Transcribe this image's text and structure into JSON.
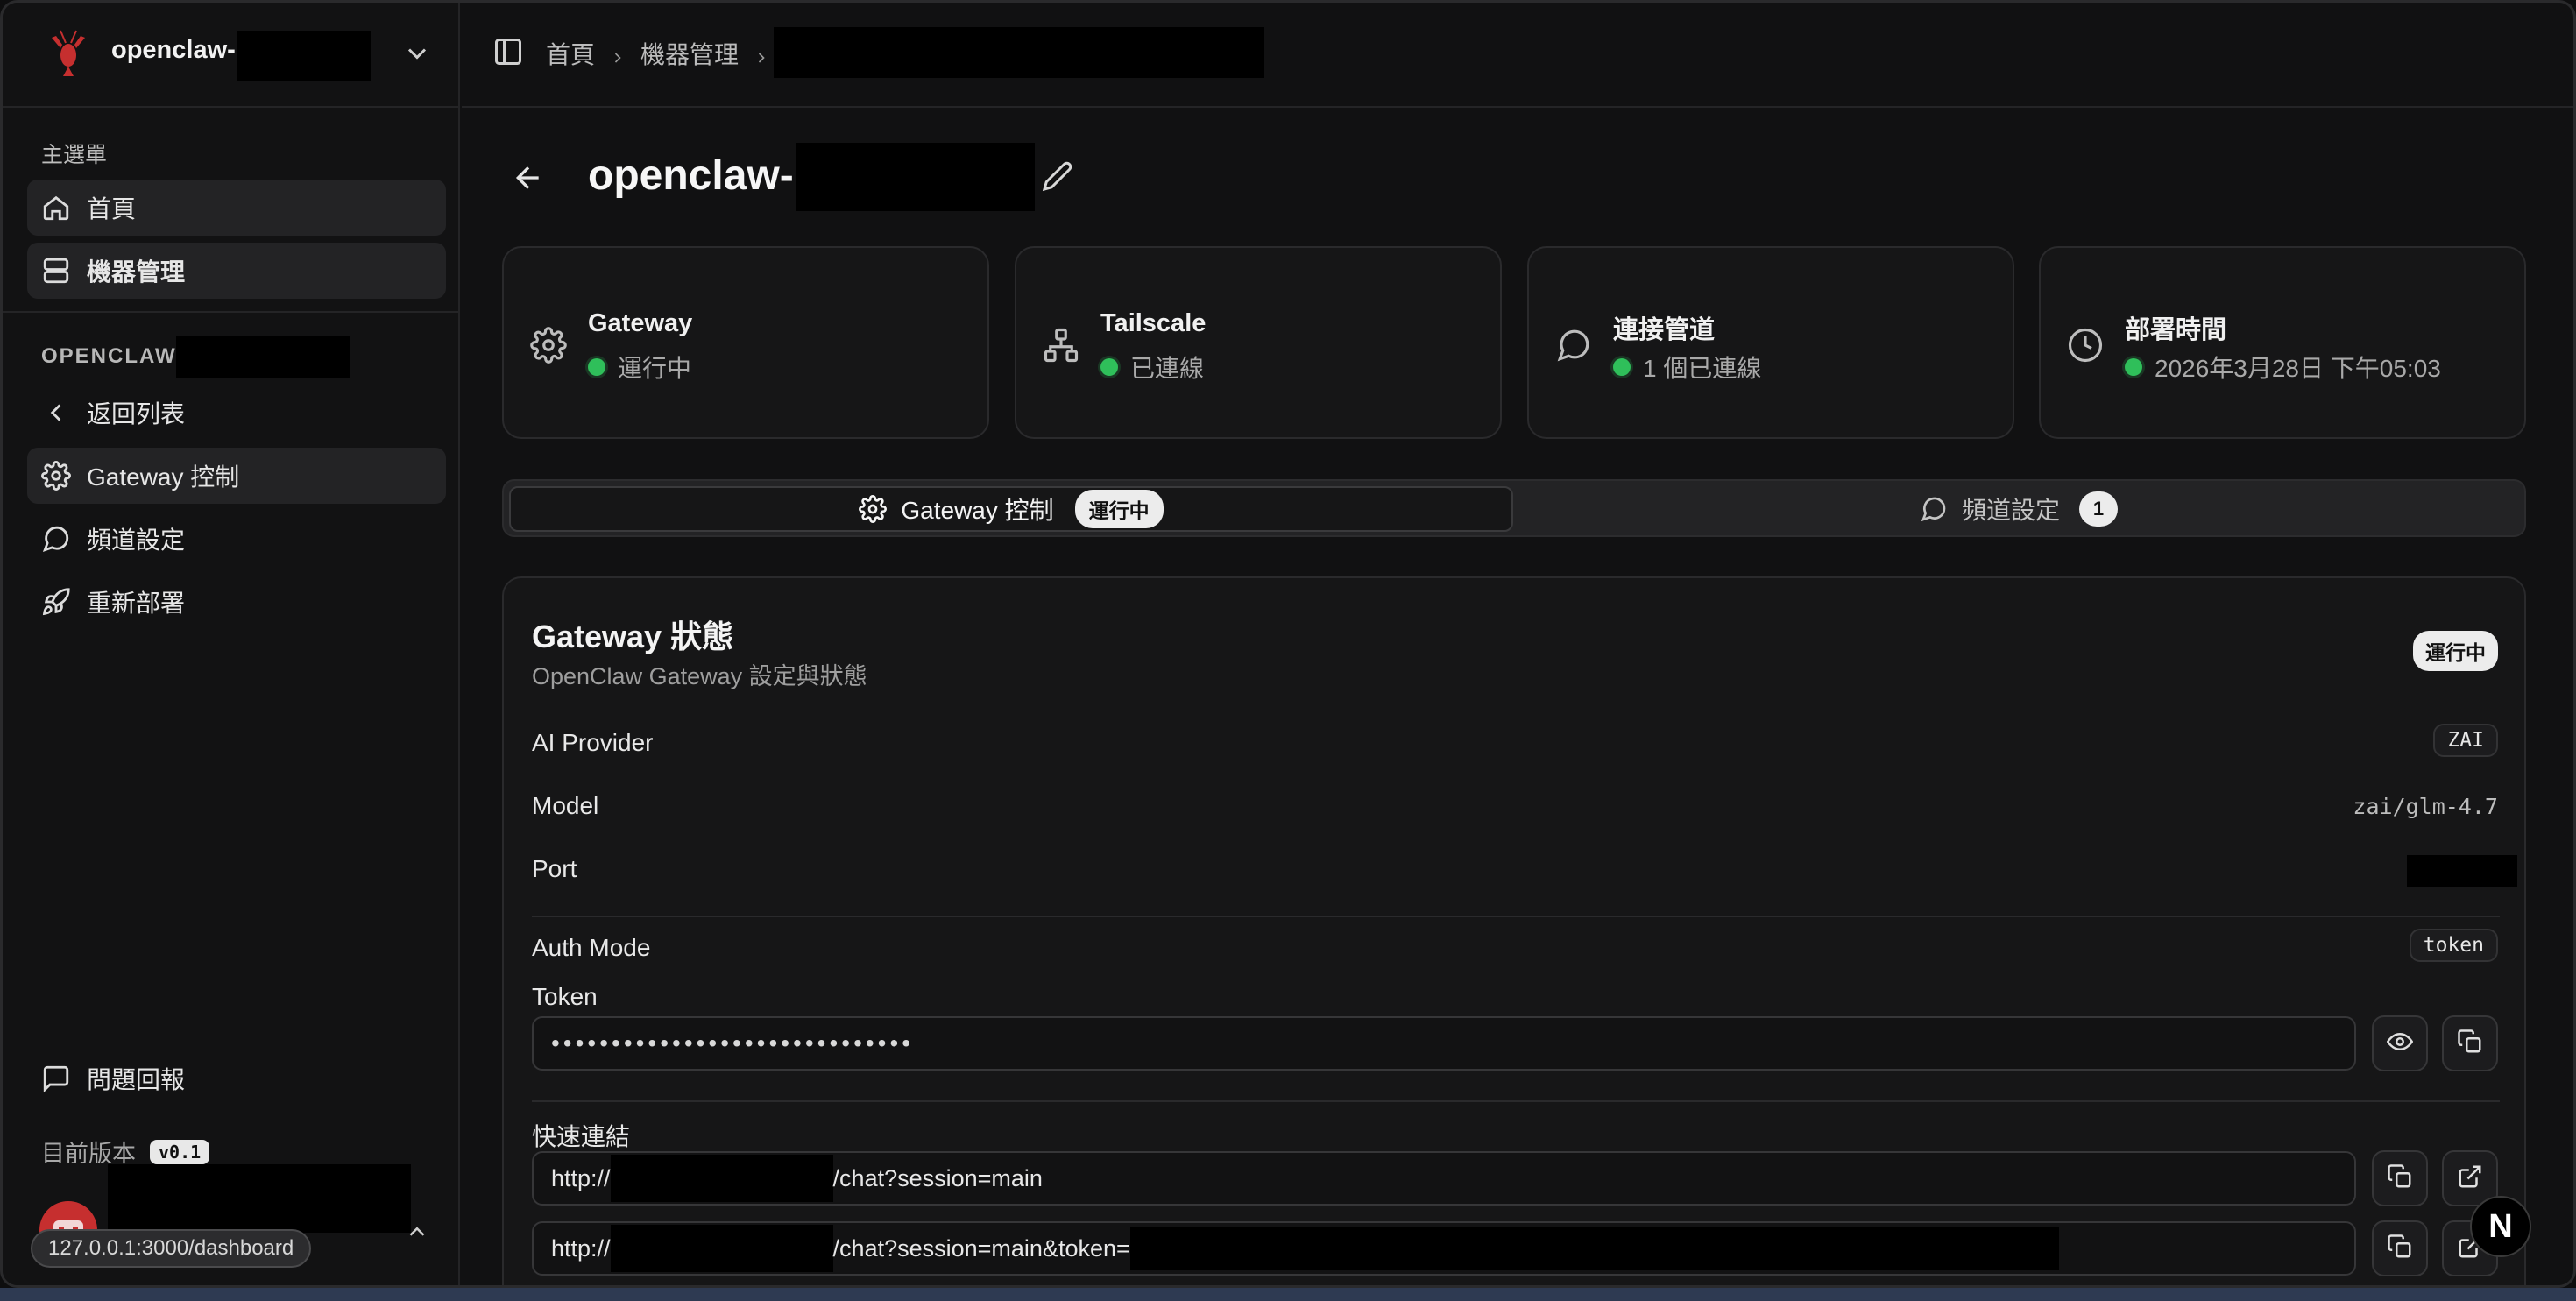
{
  "sidebar": {
    "app_name": "openclaw-",
    "main_menu_label": "主選單",
    "nav": [
      {
        "label": "首頁",
        "icon": "home-icon"
      },
      {
        "label": "機器管理",
        "icon": "server-icon"
      }
    ],
    "machine_section_label": "OPENCLAW-",
    "machine_nav": [
      {
        "label": "返回列表",
        "icon": "chevron-left-icon"
      },
      {
        "label": "Gateway 控制",
        "icon": "gear-icon"
      },
      {
        "label": "頻道設定",
        "icon": "message-circle-icon"
      },
      {
        "label": "重新部署",
        "icon": "rocket-icon"
      }
    ],
    "feedback_label": "問題回報",
    "version_label": "目前版本",
    "version_value": "v0.1",
    "hover_url": "127.0.0.1:3000/dashboard"
  },
  "breadcrumb": {
    "items": [
      "首頁",
      "機器管理"
    ]
  },
  "page": {
    "title": "openclaw-"
  },
  "status_cards": [
    {
      "title": "Gateway",
      "status": "運行中",
      "icon": "gear-icon"
    },
    {
      "title": "Tailscale",
      "status": "已連線",
      "icon": "network-icon"
    },
    {
      "title": "連接管道",
      "status": "1 個已連線",
      "icon": "message-circle-icon"
    },
    {
      "title": "部署時間",
      "status": "2026年3月28日 下午05:03",
      "icon": "clock-icon"
    }
  ],
  "status_color": "#2fbf5a",
  "tabs": [
    {
      "label": "Gateway 控制",
      "badge": "運行中",
      "active": true
    },
    {
      "label": "頻道設定",
      "badge": "1",
      "active": false
    }
  ],
  "gateway_panel": {
    "title": "Gateway 狀態",
    "subtitle": "OpenClaw Gateway 設定與狀態",
    "status_badge": "運行中",
    "ai_provider_label": "AI Provider",
    "ai_provider_value": "ZAI",
    "model_label": "Model",
    "model_value": "zai/glm-4.7",
    "port_label": "Port",
    "auth_mode_label": "Auth Mode",
    "auth_mode_value": "token",
    "token_label": "Token",
    "token_masked": "••••••••••••••••••••••••••••••",
    "quick_links_label": "快速連結",
    "link1_prefix": "http://",
    "link1_suffix": "/chat?session=main",
    "link2_prefix": "http://",
    "link2_suffix": "/chat?session=main&token="
  },
  "floating_badge": "N"
}
